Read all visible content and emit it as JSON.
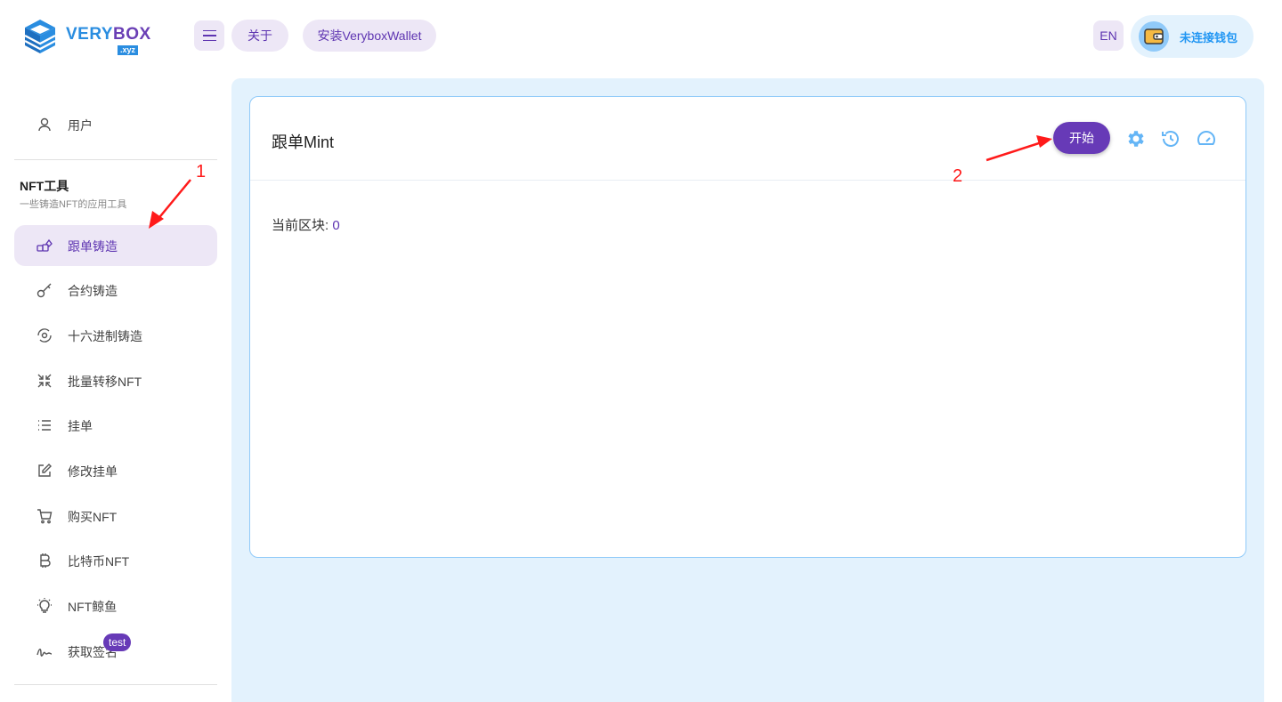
{
  "header": {
    "logo_very": "VERY",
    "logo_box": "BOX",
    "logo_xyz": ".xyz",
    "about_label": "关于",
    "install_label": "安装VeryboxWallet",
    "lang_label": "EN",
    "wallet_label": "未连接钱包"
  },
  "sidebar": {
    "user_label": "用户",
    "section_title": "NFT工具",
    "section_subtitle": "一些铸造NFT的应用工具",
    "items": [
      {
        "label": "跟单铸造",
        "icon": "mint-follow-icon",
        "active": true
      },
      {
        "label": "合约铸造",
        "icon": "key-icon"
      },
      {
        "label": "十六进制铸造",
        "icon": "refresh-circle-icon"
      },
      {
        "label": "批量转移NFT",
        "icon": "arrows-in-icon"
      },
      {
        "label": "挂单",
        "icon": "list-icon"
      },
      {
        "label": "修改挂单",
        "icon": "edit-icon"
      },
      {
        "label": "购买NFT",
        "icon": "cart-icon"
      },
      {
        "label": "比特币NFT",
        "icon": "bitcoin-icon"
      },
      {
        "label": "NFT鲸鱼",
        "icon": "bulb-icon"
      },
      {
        "label": "获取签名",
        "icon": "signature-icon"
      }
    ],
    "badge": "test"
  },
  "main": {
    "card_title": "跟单Mint",
    "start_label": "开始",
    "block_label": "当前区块: ",
    "block_value": "0"
  },
  "annotations": {
    "num1": "1",
    "num2": "2",
    "color": "#ff1a1a"
  },
  "colors": {
    "accent": "#673ab7",
    "accent_light": "#ede7f6",
    "blue": "#2196f3",
    "main_bg": "#e3f2fd"
  }
}
